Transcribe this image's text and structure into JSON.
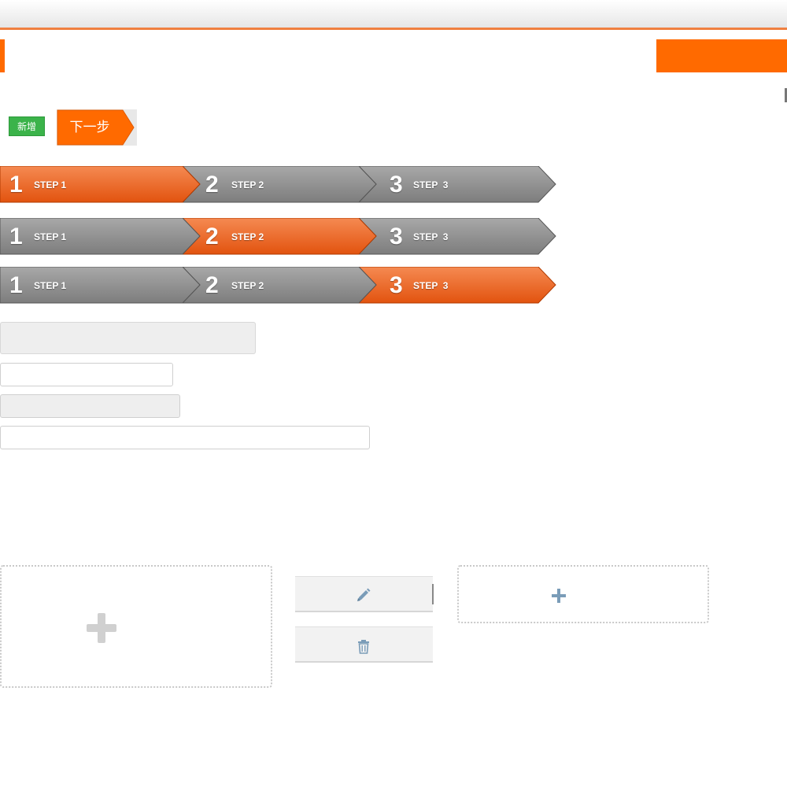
{
  "toolbar": {
    "add_label": "新增",
    "next_label": "下一步"
  },
  "steps": [
    {
      "num": "1",
      "label": "STEP 1"
    },
    {
      "num": "2",
      "label": "STEP 2"
    },
    {
      "num": "3",
      "label": "STEP  3"
    }
  ],
  "step_bars_active": [
    1,
    2,
    3
  ],
  "colors": {
    "accent": "#ff6a00",
    "active_step_top": "#f58a52",
    "active_step_bottom": "#e2530f",
    "inactive_step_top": "#a8a8a8",
    "inactive_step_bottom": "#7d7d7d",
    "add_button": "#3bb34a"
  },
  "form": {
    "field1_value": "",
    "field2_value": "",
    "field3_value": "",
    "field4_value": ""
  },
  "icons": {
    "upload": "plus-icon",
    "edit": "pencil-icon",
    "delete": "trash-icon",
    "add": "plus-icon"
  }
}
